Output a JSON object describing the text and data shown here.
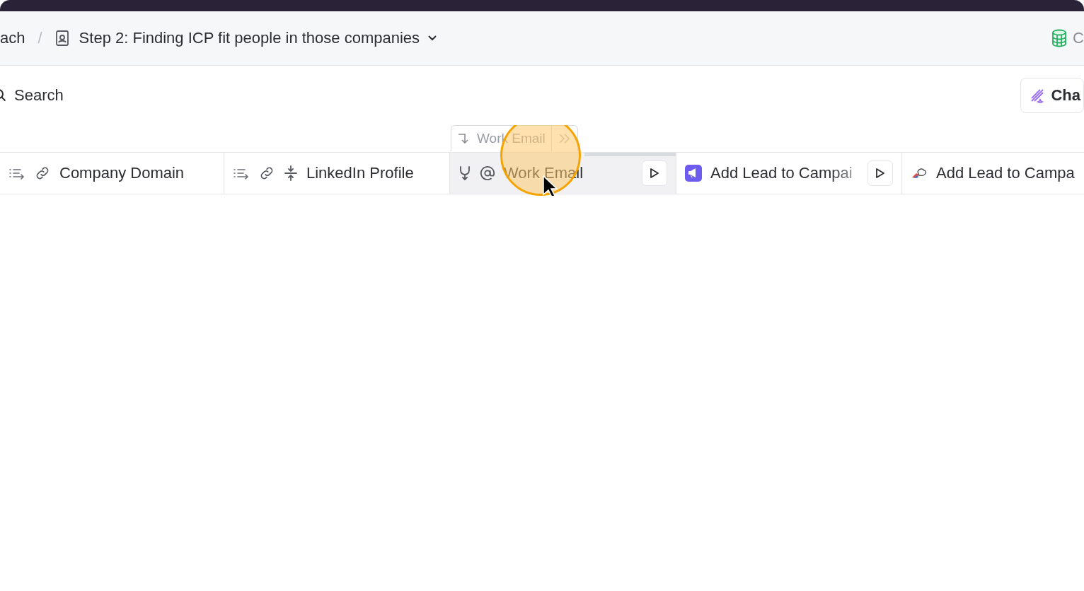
{
  "breadcrumb": {
    "parent": "ach",
    "separator": "/",
    "current": "Step 2: Finding ICP fit people in those companies"
  },
  "top_right": {
    "label": "C"
  },
  "search": {
    "placeholder": "Search"
  },
  "toolbar_button": {
    "label": "Cha"
  },
  "drag_preview": {
    "label": "Work Email"
  },
  "columns": [
    {
      "label": "Company Domain",
      "kind": "domain",
      "run_button": false,
      "selected": false
    },
    {
      "label": "LinkedIn Profile",
      "kind": "profile",
      "run_button": false,
      "selected": false
    },
    {
      "label": "Work Email",
      "kind": "email",
      "run_button": true,
      "selected": true
    },
    {
      "label": "Add Lead to Campai",
      "kind": "campaign",
      "run_button": true,
      "selected": false
    },
    {
      "label": "Add Lead to Campa",
      "kind": "outreach",
      "run_button": false,
      "selected": false
    }
  ]
}
